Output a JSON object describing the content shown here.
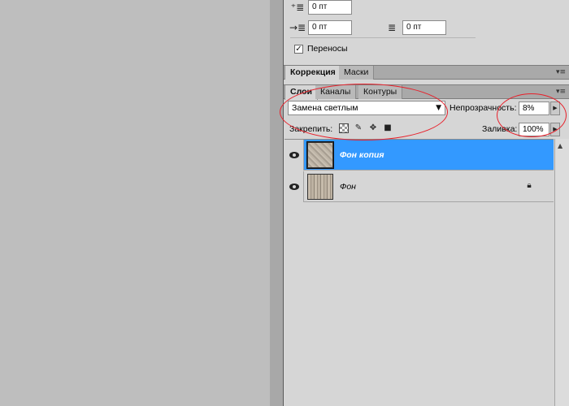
{
  "paragraph_panel": {
    "space_before": "0 пт",
    "indent_left": "0 пт",
    "indent_right": "0 пт",
    "hyphenation_label": "Переносы",
    "hyphenation_checked": "✓"
  },
  "correction_panel": {
    "tabs": [
      "Коррекция",
      "Маски"
    ]
  },
  "layers_panel": {
    "tabs": [
      "Слои",
      "Каналы",
      "Контуры"
    ],
    "blend_mode": "Замена светлым",
    "opacity_label": "Непрозрачность:",
    "opacity_value": "8%",
    "lock_label": "Закрепить:",
    "fill_label": "Заливка:",
    "fill_value": "100%",
    "layers": [
      {
        "name": "Фон копия",
        "selected": true
      },
      {
        "name": "Фон",
        "selected": false,
        "locked": true
      }
    ]
  },
  "icons": {
    "panel_menu": "panel-menu-icon",
    "eye": "eye-icon",
    "lock": "lock-icon"
  },
  "colors": {
    "selection": "#3399ff",
    "annotation": "#e8202a"
  }
}
